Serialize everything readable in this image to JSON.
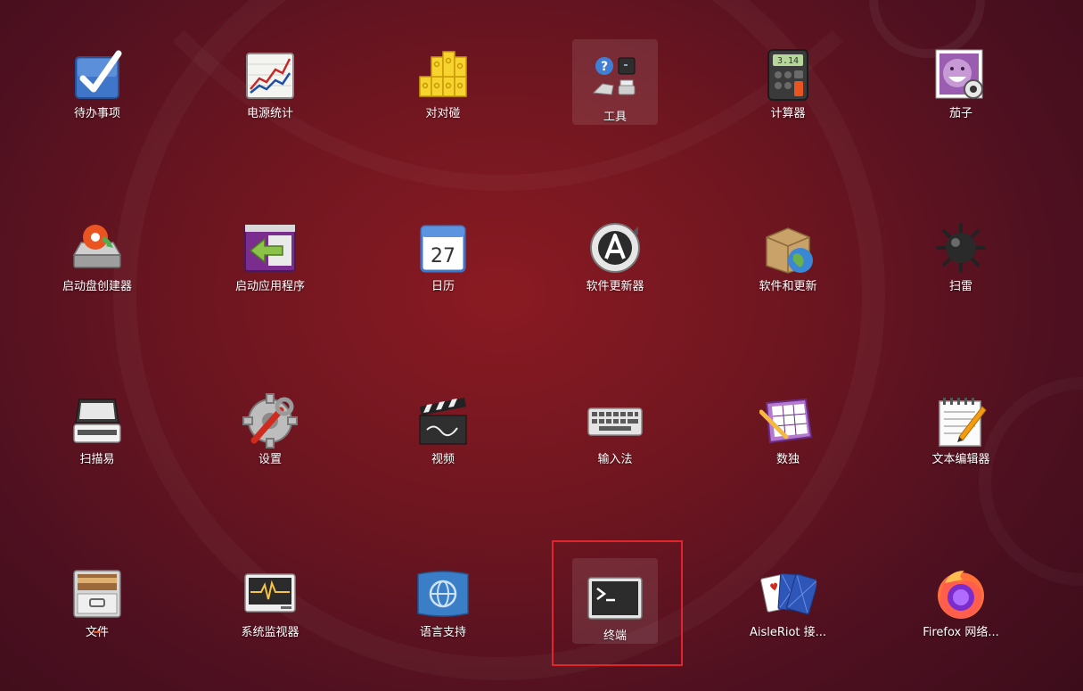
{
  "apps": [
    {
      "label": "待办事项",
      "icon": "todo-checkbox-icon"
    },
    {
      "label": "电源统计",
      "icon": "power-statistics-chart-icon"
    },
    {
      "label": "对对碰",
      "icon": "swell-foop-blocks-icon"
    },
    {
      "label": "工具",
      "icon": "utilities-folder-icon"
    },
    {
      "label": "计算器",
      "icon": "calculator-icon"
    },
    {
      "label": "茄子",
      "icon": "cheese-webcam-icon"
    },
    {
      "label": "启动盘创建器",
      "icon": "startup-disk-creator-icon"
    },
    {
      "label": "启动应用程序",
      "icon": "startup-applications-icon"
    },
    {
      "label": "日历",
      "icon": "calendar-icon",
      "day": "27"
    },
    {
      "label": "软件更新器",
      "icon": "software-updater-icon"
    },
    {
      "label": "软件和更新",
      "icon": "software-properties-icon"
    },
    {
      "label": "扫雷",
      "icon": "mines-icon"
    },
    {
      "label": "扫描易",
      "icon": "scanner-icon"
    },
    {
      "label": "设置",
      "icon": "settings-gear-icon"
    },
    {
      "label": "视频",
      "icon": "video-clapperboard-icon"
    },
    {
      "label": "输入法",
      "icon": "keyboard-input-method-icon"
    },
    {
      "label": "数独",
      "icon": "sudoku-icon"
    },
    {
      "label": "文本编辑器",
      "icon": "text-editor-icon"
    },
    {
      "label": "文件",
      "icon": "files-cabinet-icon",
      "running": true
    },
    {
      "label": "系统监视器",
      "icon": "system-monitor-icon"
    },
    {
      "label": "语言支持",
      "icon": "language-support-flag-icon"
    },
    {
      "label": "终端",
      "icon": "terminal-icon",
      "highlighted": true
    },
    {
      "label": "AisleRiot 接...",
      "icon": "aisleriot-cards-icon"
    },
    {
      "label": "Firefox 网络...",
      "icon": "firefox-icon"
    }
  ],
  "colors": {
    "background": "#6f1620",
    "accent": "#e95420",
    "focus_outline": "#e0252b"
  }
}
